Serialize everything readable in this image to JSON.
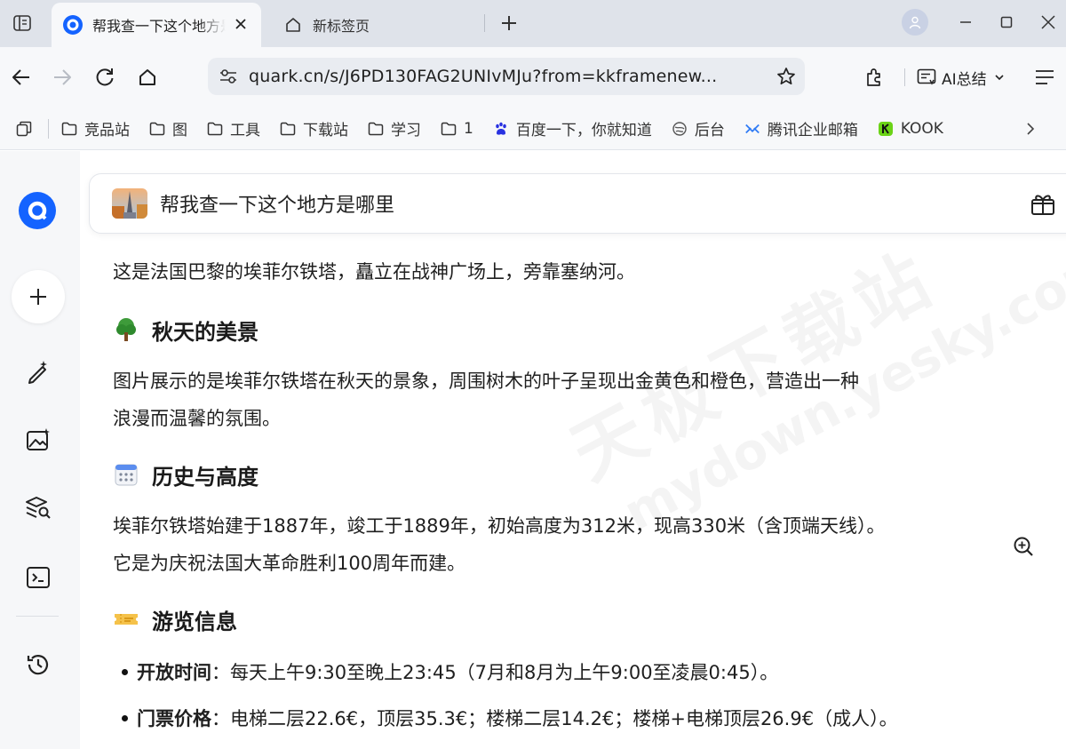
{
  "tabs": [
    {
      "title": "帮我查一下这个地方是哪里",
      "active": true
    },
    {
      "title": "新标签页",
      "active": false
    }
  ],
  "toolbar": {
    "url": "quark.cn/s/J6PD130FAG2UNIvMJu?from=kkframenew...",
    "ai_summary_label": "AI总结"
  },
  "bookmarks": [
    {
      "label": "竞品站",
      "icon": "folder-icon"
    },
    {
      "label": "图",
      "icon": "folder-icon"
    },
    {
      "label": "工具",
      "icon": "folder-icon"
    },
    {
      "label": "下载站",
      "icon": "folder-icon"
    },
    {
      "label": "学习",
      "icon": "folder-icon"
    },
    {
      "label": "1",
      "icon": "folder-icon"
    },
    {
      "label": "百度一下，你就知道",
      "icon": "baidu-paw-icon"
    },
    {
      "label": "后台",
      "icon": "globe-icon"
    },
    {
      "label": "腾讯企业邮箱",
      "icon": "tencent-mail-icon"
    },
    {
      "label": "KOOK",
      "icon": "kook-icon"
    }
  ],
  "query": {
    "text": "帮我查一下这个地方是哪里"
  },
  "answer": {
    "intro": "这是法国巴黎的埃菲尔铁塔，矗立在战神广场上，旁靠塞纳河。",
    "sections": [
      {
        "icon": "tree-emoji",
        "heading": "秋天的美景",
        "lines": [
          "图片展示的是埃菲尔铁塔在秋天的景象，周围树木的叶子呈现出金黄色和橙色，营造出一种",
          "浪漫而温馨的氛围。"
        ]
      },
      {
        "icon": "calendar-emoji",
        "heading": "历史与高度",
        "lines": [
          "埃菲尔铁塔始建于1887年，竣工于1889年，初始高度为312米，现高330米（含顶端天线）。",
          "它是为庆祝法国大革命胜利100周年而建。"
        ]
      },
      {
        "icon": "ticket-emoji",
        "heading": "游览信息",
        "bullets": [
          {
            "label": "开放时间",
            "text": "：每天上午9:30至晚上23:45（7月和8月为上午9:00至凌晨0:45）。"
          },
          {
            "label": "门票价格",
            "text": "：电梯二层22.6€，顶层35.3€；楼梯二层14.2€；楼梯+电梯顶层26.9€（成人）。"
          }
        ]
      }
    ]
  },
  "watermark": {
    "line1": "天极下载站",
    "line2": "mydown.yesky.com"
  },
  "colors": {
    "brand": "#1463ff",
    "tabbar": "#dfe3ea",
    "toolbar": "#f7f8fa"
  }
}
